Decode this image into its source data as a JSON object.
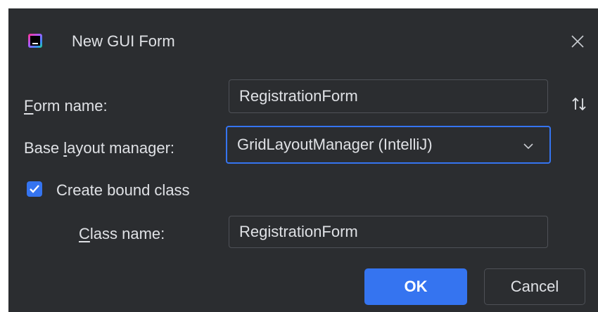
{
  "window": {
    "title": "New GUI Form",
    "app_icon": "intellij-gui-designer-icon",
    "close_icon": "close-icon"
  },
  "form": {
    "form_name_label_mnemonic": "F",
    "form_name_label_rest": "orm name:",
    "form_name_value": "RegistrationForm",
    "sort_icon": "sort-arrows-icon",
    "layout_label_before": "Base ",
    "layout_label_mnemonic": "l",
    "layout_label_after": "ayout manager:",
    "layout_value": "GridLayoutManager (IntelliJ)",
    "dropdown_icon": "chevron-down-icon",
    "bound_class_checked": true,
    "bound_class_label": "Create bound class",
    "class_name_label_mnemonic": "C",
    "class_name_label_rest": "lass name:",
    "class_name_value": "RegistrationForm"
  },
  "buttons": {
    "ok": "OK",
    "cancel": "Cancel"
  },
  "colors": {
    "dialog_bg": "#2b2d30",
    "accent": "#3574f0",
    "text": "#dfe1e5",
    "field_border": "#4e5157"
  }
}
